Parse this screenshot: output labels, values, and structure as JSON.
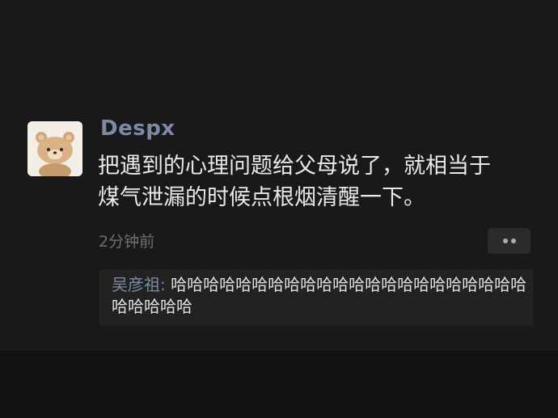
{
  "post": {
    "username": "Despx",
    "text": "把遇到的心理问题给父母说了，就相当于\n煤气泄漏的时候点根烟清醒一下。",
    "timestamp": "2分钟前",
    "avatar_icon": "bear-cartoon-avatar",
    "more_icon": "more-dots-icon"
  },
  "comment": {
    "author": "吴彦祖",
    "separator": ": ",
    "text": "哈哈哈哈哈哈哈哈哈哈哈哈哈哈哈哈哈哈哈哈哈哈哈哈哈哈哈"
  },
  "colors": {
    "background": "#191919",
    "name_link": "#7d8aa6",
    "body_text": "#e9e9e9",
    "muted_text": "#707070",
    "comment_bg": "#222222"
  }
}
